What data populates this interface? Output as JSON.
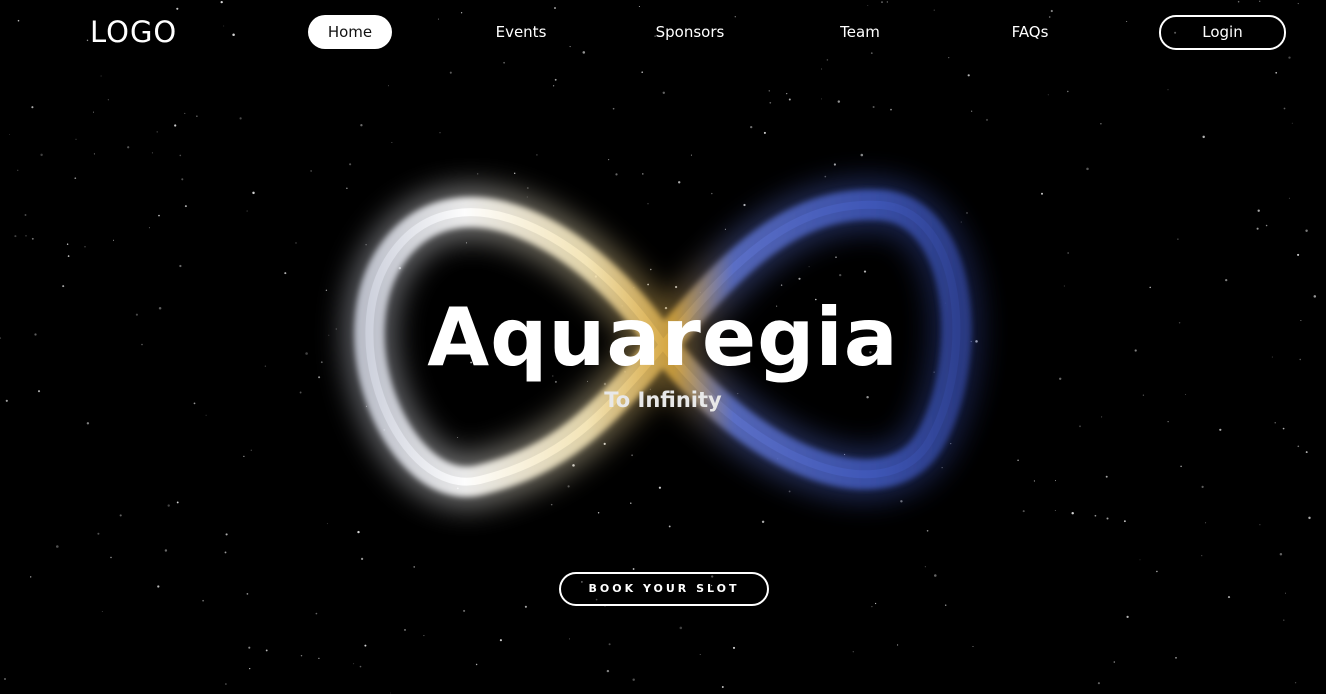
{
  "header": {
    "logo": "LOGO",
    "nav": [
      {
        "label": "Home",
        "active": true
      },
      {
        "label": "Events",
        "active": false
      },
      {
        "label": "Sponsors",
        "active": false
      },
      {
        "label": "Team",
        "active": false
      },
      {
        "label": "FAQs",
        "active": false
      }
    ],
    "login_label": "Login"
  },
  "hero": {
    "title": "Aquaregia",
    "subtitle": "To Infinity",
    "cta_label": "BOOK YOUR SLOT"
  },
  "colors": {
    "background": "#000000",
    "text": "#ffffff",
    "loop_left": "#e6e9f2",
    "loop_center": "#e0b552",
    "loop_right": "#4a63c9"
  },
  "icons": {
    "hero_graphic": "infinity-symbol"
  }
}
